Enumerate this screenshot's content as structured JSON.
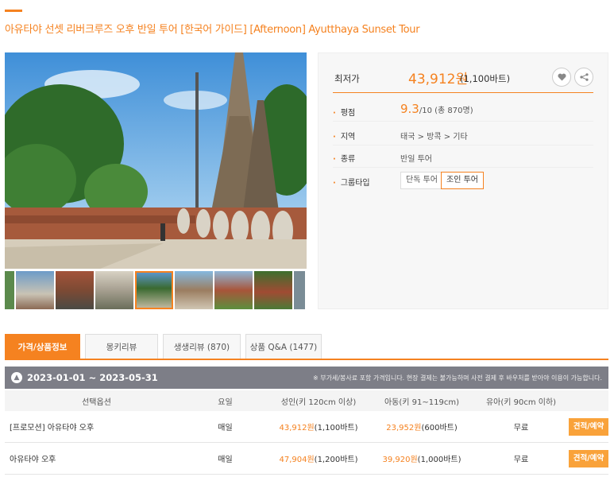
{
  "header": {
    "title": "아유타야 선셋 리버크루즈 오후 반일 투어 [한국어 가이드]   [Afternoon] Ayutthaya Sunset Tour"
  },
  "summary": {
    "price_label": "최저가",
    "price": "43,912원",
    "price_sub": "(1,100바트)",
    "wish_icon": "heart-icon",
    "share_icon": "share-icon",
    "rating_label": "평점",
    "rating_value": "9.3",
    "rating_sub": "/10 (총 870명)",
    "region_label": "지역",
    "region_value": "태국 > 방콕 > 기타",
    "kind_label": "종류",
    "kind_value": "반일 투어",
    "group_label": "그룹타입",
    "group_options": [
      "단독 투어",
      "조인 투어"
    ],
    "group_selected": "조인 투어"
  },
  "tabs": [
    {
      "label": "가격/상품정보",
      "active": true
    },
    {
      "label": "몽키리뷰",
      "active": false
    },
    {
      "label": "생생리뷰 (870)",
      "active": false
    },
    {
      "label": "상품 Q&A (1477)",
      "active": false
    }
  ],
  "period": {
    "range": "2023-01-01 ~ 2023-05-31",
    "note": "※ 부가세/봉사료 포함 가격입니다. 현장 결제는 불가능하며 사전 결제 후 바우처를 받아야 이용이 가능합니다."
  },
  "table": {
    "headers": [
      "선택옵션",
      "요일",
      "성인(키 120cm 이상)",
      "아동(키 91~119cm)",
      "유아(키 90cm 이하)"
    ],
    "rows": [
      {
        "option": "[프로모션] 아유타야 오후",
        "day": "매일",
        "adult_price": "43,912원",
        "adult_baht": "(1,100바트)",
        "child_price": "23,952원",
        "child_baht": "(600바트)",
        "infant": "무료",
        "button": "견적/예약"
      },
      {
        "option": "아유타야 오후",
        "day": "매일",
        "adult_price": "47,904원",
        "adult_baht": "(1,200바트)",
        "child_price": "39,920원",
        "child_baht": "(1,000바트)",
        "infant": "무료",
        "button": "견적/예약"
      }
    ]
  },
  "colors": {
    "accent": "#f58220",
    "date_bar": "#7d7e87",
    "button": "#f9a23a"
  }
}
